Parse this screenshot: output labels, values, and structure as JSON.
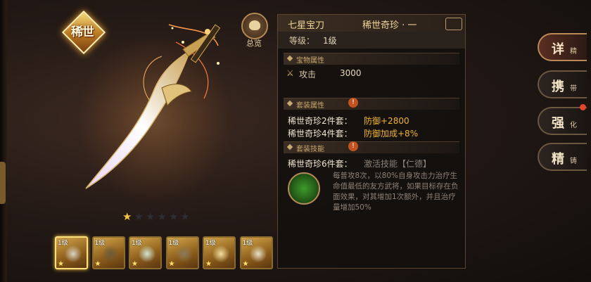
{
  "rarity_badge": "稀世",
  "overview_label": "总览",
  "stars": {
    "filled": 1,
    "total": 6
  },
  "slots": [
    {
      "level": "1级",
      "selected": true
    },
    {
      "level": "1级",
      "selected": false
    },
    {
      "level": "1级",
      "selected": false
    },
    {
      "level": "1级",
      "selected": false
    },
    {
      "level": "1级",
      "selected": false
    },
    {
      "level": "1级",
      "selected": false
    }
  ],
  "panel": {
    "title": "七星宝刀",
    "rarity": "稀世奇珍 · 一",
    "level_label": "等级：",
    "level_value": "1级",
    "attr_section": "宝物属性",
    "attr_name": "攻击",
    "attr_value": "3000",
    "set_section": "套装属性",
    "set2_label": "稀世奇珍2件套：",
    "set2_value": "防御+2800",
    "set4_label": "稀世奇珍4件套：",
    "set4_value": "防御加成+8%",
    "skill_section": "套装技能",
    "skill_label": "稀世奇珍6件套：",
    "skill_name": "激活技能【仁德】",
    "skill_desc": "每普攻8次，以80%自身攻击力治疗生命值最低的友方武将，如果目标存在负面效果，对其增加1次额外，并且治疗量增加50%"
  },
  "tabs": [
    {
      "big": "详",
      "small": "精"
    },
    {
      "big": "携",
      "small": "带"
    },
    {
      "big": "强",
      "small": "化"
    },
    {
      "big": "精",
      "small": "铸"
    }
  ],
  "colors": {
    "accent_gold": "#f3b531",
    "panel_bg": "#14100e",
    "star_on": "#f3c445"
  }
}
